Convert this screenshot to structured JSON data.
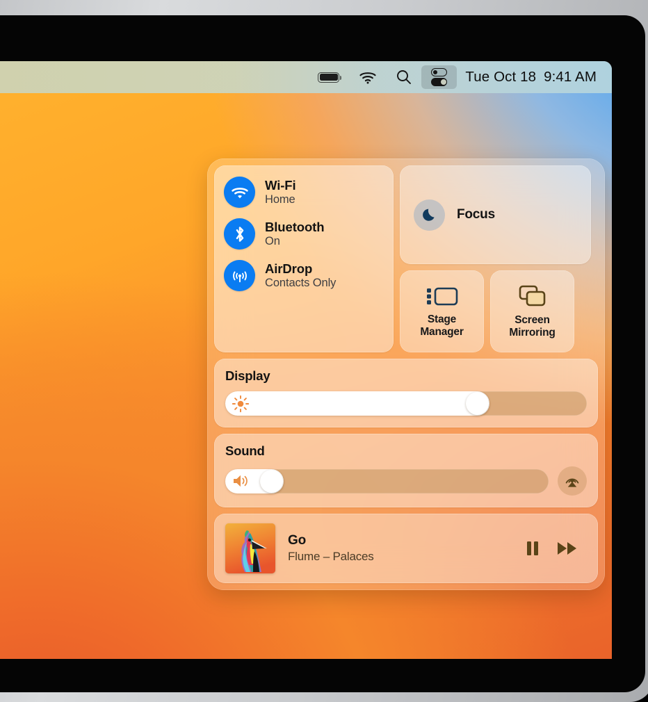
{
  "menubar": {
    "battery": {
      "icon": "battery-icon",
      "level": 100
    },
    "wifi": {
      "icon": "wifi-icon"
    },
    "search": {
      "icon": "search-icon"
    },
    "control_center": {
      "icon": "control-center-icon",
      "active": true
    },
    "date": "Tue Oct 18",
    "time": "9:41 AM"
  },
  "control_center": {
    "connectivity": [
      {
        "icon": "wifi-icon",
        "title": "Wi-Fi",
        "status": "Home"
      },
      {
        "icon": "bluetooth-icon",
        "title": "Bluetooth",
        "status": "On"
      },
      {
        "icon": "airdrop-icon",
        "title": "AirDrop",
        "status": "Contacts Only"
      }
    ],
    "focus": {
      "icon": "moon-icon",
      "label": "Focus"
    },
    "tiles": [
      {
        "icon": "stage-manager-icon",
        "label_line1": "Stage",
        "label_line2": "Manager"
      },
      {
        "icon": "screen-mirroring-icon",
        "label_line1": "Screen",
        "label_line2": "Mirroring"
      }
    ],
    "display": {
      "title": "Display",
      "glyph": "brightness-icon",
      "value": 73
    },
    "sound": {
      "title": "Sound",
      "glyph": "volume-icon",
      "value": 18,
      "airplay": {
        "icon": "airplay-icon"
      }
    },
    "now_playing": {
      "artwork": "album-art-bird",
      "title": "Go",
      "subtitle": "Flume – Palaces",
      "controls": [
        {
          "icon": "pause-icon"
        },
        {
          "icon": "fast-forward-icon"
        }
      ]
    }
  },
  "colors": {
    "accent_blue": "#0a7cf2",
    "menubar_text": "#0d0d0d",
    "slider_fill": "#ffffff",
    "warm_icon": "#5a4418"
  }
}
